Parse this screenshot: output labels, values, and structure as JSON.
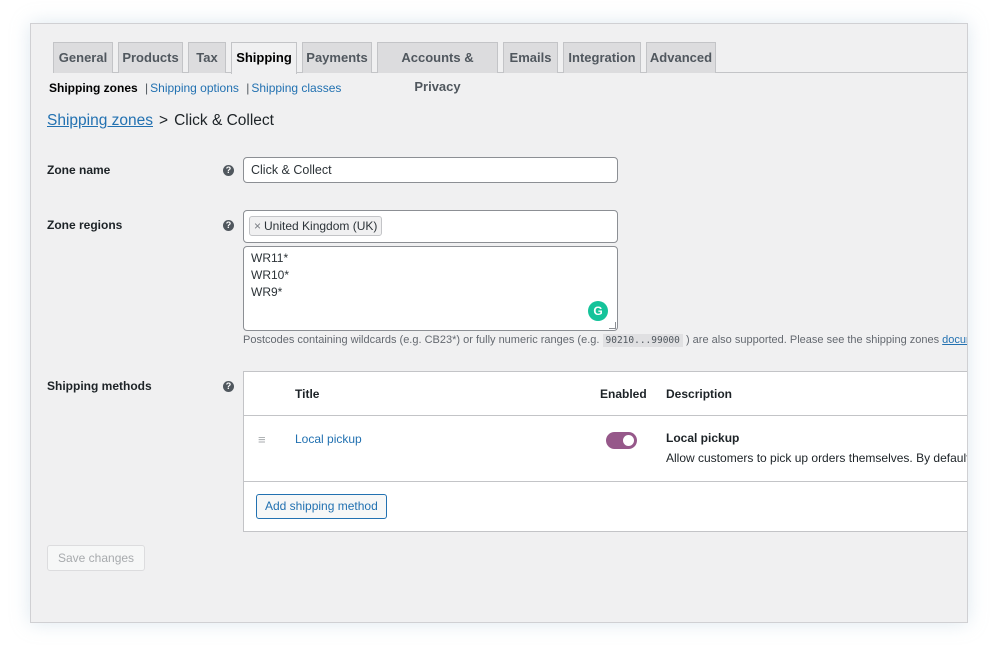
{
  "tabs": [
    "General",
    "Products",
    "Tax",
    "Shipping",
    "Payments",
    "Accounts & Privacy",
    "Emails",
    "Integration",
    "Advanced"
  ],
  "active_tab": "Shipping",
  "subnav": {
    "current": "Shipping zones",
    "sep": "|",
    "options": "Shipping options",
    "classes": "Shipping classes"
  },
  "heading": {
    "link": "Shipping zones",
    "separator": ">",
    "title": "Click & Collect"
  },
  "zone_name": {
    "label": "Zone name",
    "value": "Click & Collect",
    "help": "?"
  },
  "zone_regions": {
    "label": "Zone regions",
    "help": "?",
    "region_remove": "×",
    "region": "United Kingdom (UK)",
    "postcodes": [
      "WR11*",
      "WR10*",
      "WR9*"
    ],
    "grammarly": "G"
  },
  "postcode_note": {
    "before": "Postcodes containing wildcards (e.g. CB23*) or fully numeric ranges (e.g.",
    "code": "90210...99000",
    "after": ") are also supported. Please see the shipping zones",
    "link": "documentation"
  },
  "shipping_methods": {
    "label": "Shipping methods",
    "help": "?",
    "columns": {
      "title": "Title",
      "enabled": "Enabled",
      "description": "Description"
    },
    "rows": [
      {
        "drag": "≡",
        "title": "Local pickup",
        "enabled": true,
        "desc_title": "Local pickup",
        "desc": "Allow customers to pick up orders themselves. By default, when using local pickup store base taxes will apply regardless of customer address."
      }
    ],
    "add_button": "Add shipping method"
  },
  "save_button": "Save changes",
  "colors": {
    "link": "#2271b1",
    "toggle_on": "#96588a",
    "grammarly": "#15c39a"
  }
}
